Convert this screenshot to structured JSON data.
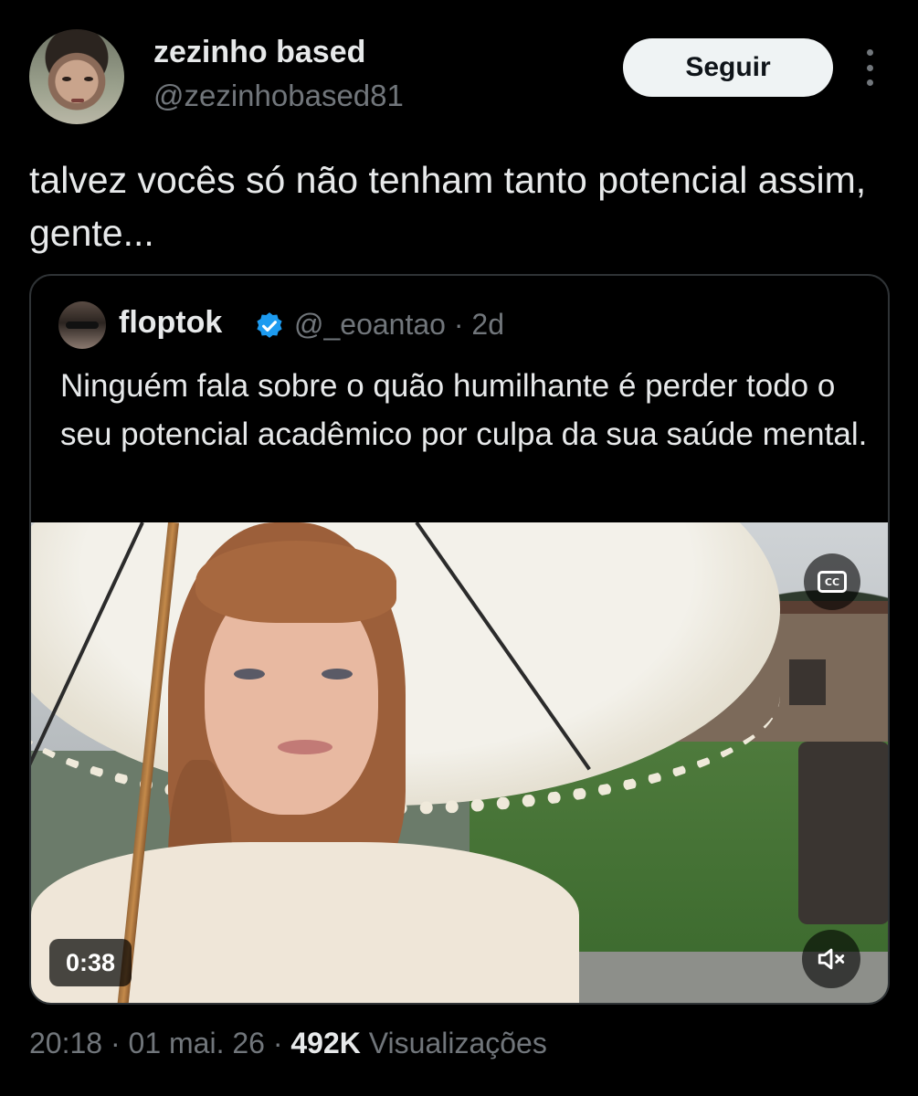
{
  "author": {
    "name": "zezinho based",
    "handle": "@zezinhobased81",
    "follow_label": "Seguir"
  },
  "tweet": {
    "text": "talvez vocês só não tenham tanto potencial assim, gente..."
  },
  "quoted_tweet": {
    "name": "floptok",
    "handle_time": "@_eoantao · 2d",
    "text": "Ninguém fala sobre o quão humilhante é perder todo o seu potencial acadêmico por culpa da sua saúde mental.",
    "video": {
      "duration": "0:38",
      "cc_label": "CC"
    }
  },
  "meta": {
    "time_date": "20:18 · 01 mai. 26 · ",
    "views_count": "492K",
    "views_label": " Visualizações"
  },
  "icons": [
    "more-options-icon",
    "verified-badge-icon",
    "closed-captions-icon",
    "muted-speaker-icon"
  ],
  "colors": {
    "background": "#000000",
    "text_primary": "#e7e9ea",
    "text_secondary": "#71767b",
    "verified_blue": "#1d9bf0",
    "follow_button_bg": "#eff3f4"
  }
}
